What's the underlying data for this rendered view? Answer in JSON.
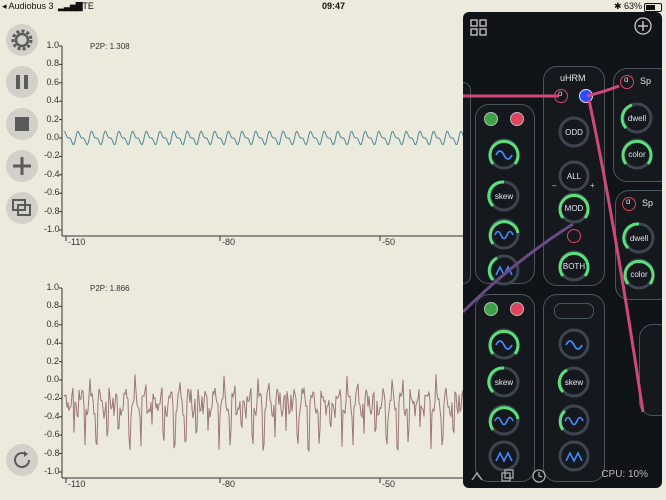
{
  "status_bar": {
    "back_app": "Audiobus 3",
    "carrier": "LTE",
    "time": "09:47",
    "battery": "63%"
  },
  "scope_top": {
    "p2p": "P2P: 1.308",
    "y_ticks": [
      "1.0",
      "0.8",
      "0.6",
      "0.4",
      "0.2",
      "0.0",
      "-0.2",
      "-0.4",
      "-0.6",
      "-0.8",
      "-1.0"
    ],
    "x_ticks": [
      "-110",
      "-80",
      "-50"
    ]
  },
  "scope_bottom": {
    "p2p": "P2P: 1.866",
    "y_ticks": [
      "1.0",
      "0.8",
      "0.6",
      "0.4",
      "0.2",
      "0.0",
      "-0.2",
      "-0.4",
      "-0.6",
      "-0.8",
      "-1.0"
    ],
    "x_ticks": [
      "-110",
      "-80",
      "-50"
    ]
  },
  "modules": {
    "uhrm_title": "uHRM",
    "odd": "ODD",
    "all": "ALL",
    "mod": "MOD",
    "both": "BOTH",
    "minus": "–",
    "plus": "+",
    "skew": "skew",
    "sp_title": "Sp",
    "sp_prefix": "ɑ",
    "dwell": "dwell",
    "color": "color"
  },
  "cpu": "CPU: 10%",
  "colors": {
    "top_wave": "#4f8a96",
    "bottom_wave": "#9b7873",
    "cable_pink": "#d2477a",
    "cable_purple": "#6a4a84",
    "ring_green": "#58e07a",
    "jack_blue": "#2a4cff",
    "jack_red": "#e0435d"
  }
}
